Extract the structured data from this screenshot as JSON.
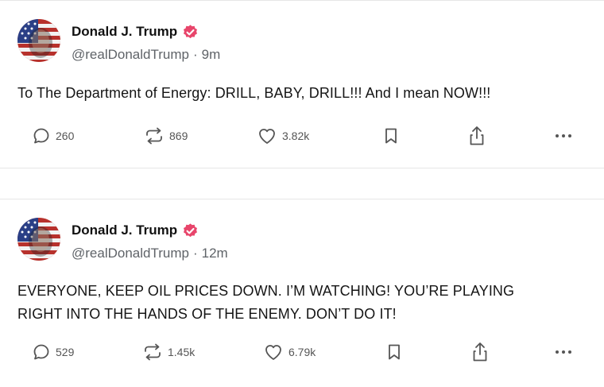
{
  "posts": [
    {
      "author": "Donald J. Trump",
      "handle": "@realDonaldTrump",
      "time": "9m",
      "text": "To The Department of Energy: DRILL, BABY, DRILL!!!  And I mean NOW!!!",
      "replies": "260",
      "reposts": "869",
      "likes": "3.82k"
    },
    {
      "author": "Donald J. Trump",
      "handle": "@realDonaldTrump",
      "time": "12m",
      "text_line1": "EVERYONE, KEEP OIL PRICES DOWN. I’M WATCHING! YOU’RE PLAYING",
      "text_line2": "RIGHT INTO THE HANDS OF THE ENEMY. DON’T DO IT!",
      "replies": "529",
      "reposts": "1.45k",
      "likes": "6.79k"
    }
  ],
  "icons": {
    "reply": "reply-icon",
    "repost": "repost-icon",
    "like": "heart-icon",
    "bookmark": "bookmark-icon",
    "share": "share-icon",
    "more": "more-icon",
    "verified": "verified-badge-icon"
  },
  "colors": {
    "verified": "#e8456b",
    "text": "#151515",
    "muted": "#5f6368",
    "icon": "#5a5a5a"
  }
}
